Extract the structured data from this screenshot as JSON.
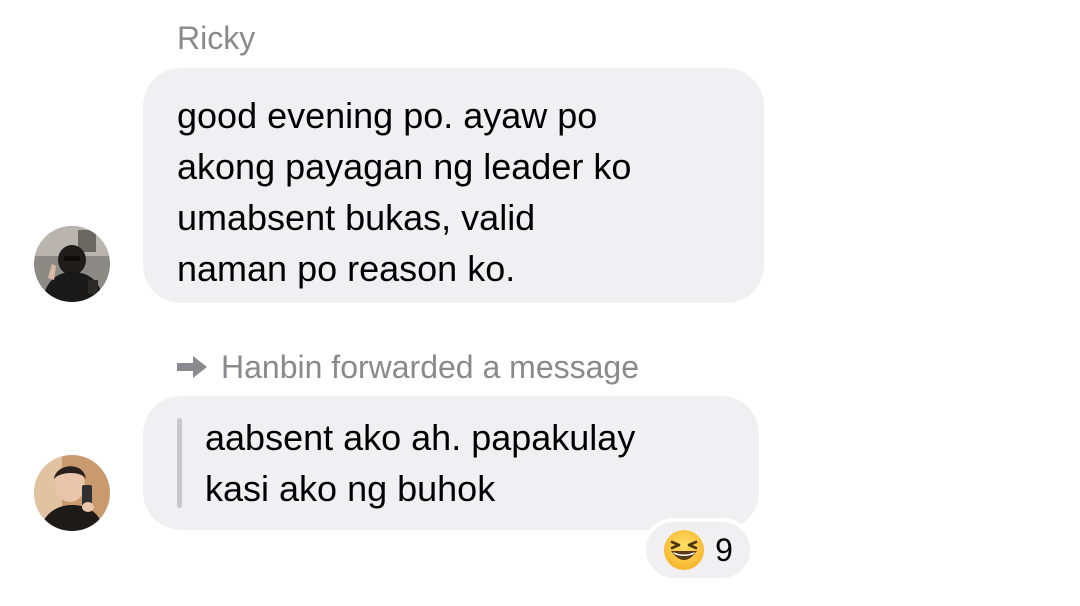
{
  "messages": [
    {
      "sender": "Ricky",
      "avatar": "avatar-ricky",
      "lines": [
        "good evening po. ayaw po",
        "akong payagan ng leader ko",
        "umabsent bukas, valid",
        "naman po reason ko."
      ]
    },
    {
      "forward_label": "Hanbin forwarded a message",
      "forward_icon": "forward-arrow-icon",
      "avatar": "avatar-hanbin",
      "lines": [
        "aabsent ako ah. papakulay",
        "kasi ako ng buhok"
      ],
      "reaction": {
        "emoji": "grinning-squinting-face",
        "count": "9"
      }
    }
  ],
  "colors": {
    "bubble": "#f0f0f2",
    "meta_text": "#8a8a8e",
    "quote_bar": "#c7c7cc"
  }
}
